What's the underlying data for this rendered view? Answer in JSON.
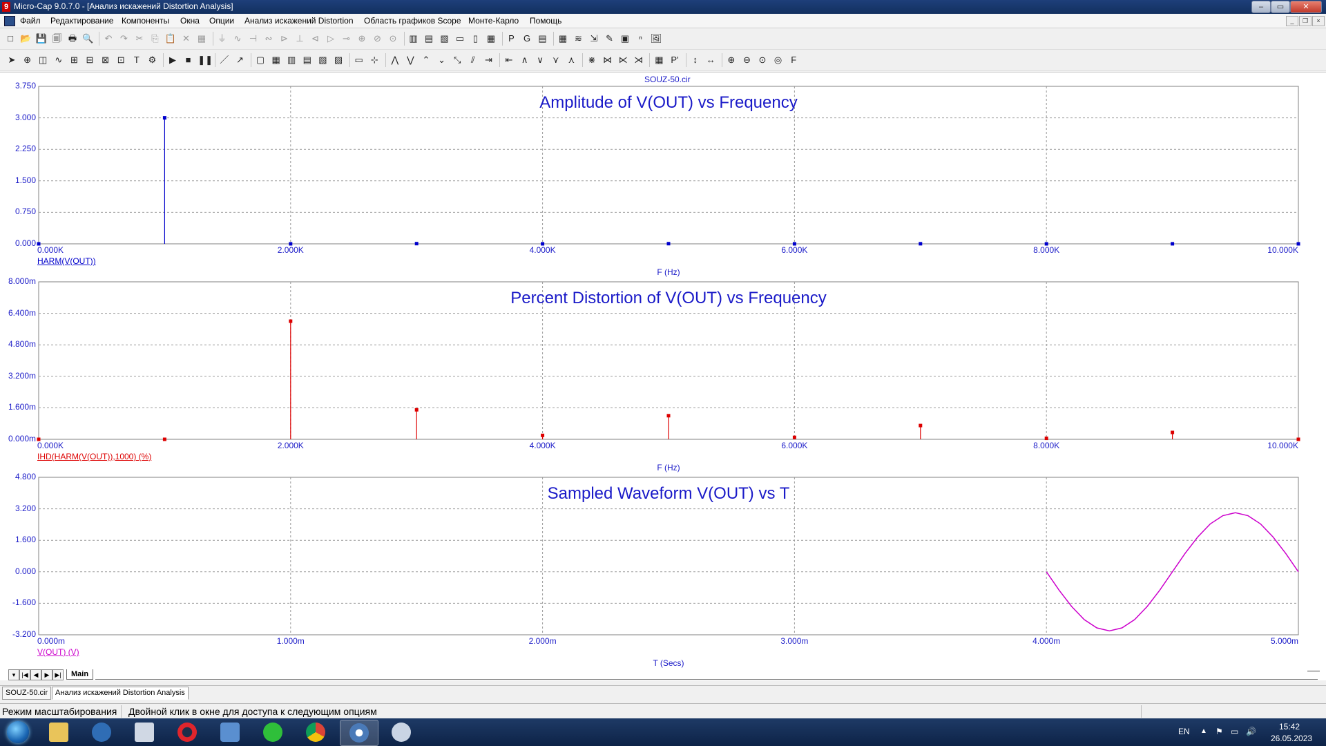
{
  "window": {
    "title": "Micro-Cap 9.0.7.0 - [Анализ искажений Distortion Analysis]",
    "app_icon": "9",
    "controls": [
      "–",
      "▭",
      "✕"
    ]
  },
  "menu": [
    "Файл",
    "Редактирование",
    "Компоненты",
    "Окна",
    "Опции",
    "Анализ искажений Distortion",
    "Область графиков Scope",
    "Монте-Карло",
    "Помощь"
  ],
  "toolbar1_icons": [
    "new-icon",
    "open-icon",
    "save-icon",
    "save-all-icon",
    "print-icon",
    "print-preview-icon",
    "undo-icon",
    "redo-icon",
    "cut-icon",
    "copy-icon",
    "paste-icon",
    "delete-icon",
    "select-all-icon",
    "ground-icon",
    "resistor-icon",
    "capacitor-icon",
    "inductor-icon",
    "diode-icon",
    "battery-icon",
    "transistor-icon",
    "opamp-icon",
    "switch-icon",
    "source-icon",
    "ammeter-icon",
    "voltmeter-icon",
    "tile-h-icon",
    "tile-v-icon",
    "cascade-icon",
    "window-icon",
    "window2-icon",
    "calculator-icon",
    "p-icon",
    "g-icon",
    "table-icon",
    "grid-icon",
    "wave-icon",
    "probe-icon",
    "pen-icon",
    "scope-icon",
    "xy-icon",
    "image-icon"
  ],
  "toolbar1_glyphs": [
    "□",
    "📂",
    "💾",
    "🗐",
    "🖶",
    "🔍",
    "↶",
    "↷",
    "✂",
    "⎘",
    "📋",
    "✕",
    "▦",
    "⏚",
    "∿",
    "⊣",
    "∾",
    "⊳",
    "⊥",
    "⊲",
    "▷",
    "⊸",
    "⊕",
    "⊘",
    "⊙",
    "▥",
    "▤",
    "▧",
    "▭",
    "▯",
    "▦",
    "P",
    "G",
    "▤",
    "▦",
    "≋",
    "⇲",
    "✎",
    "▣",
    "ⁿ",
    "🖼"
  ],
  "toolbar2_icons": [
    "pointer-icon",
    "zoom-select-icon",
    "graph-select-icon",
    "wave-tool-icon",
    "tag-icon",
    "tag2-icon",
    "tag3-icon",
    "tag4-icon",
    "text-icon",
    "properties-icon",
    "run-icon",
    "stop-icon",
    "pause-icon",
    "line-icon",
    "arrow-line-icon",
    "box-icon",
    "grid-toggle-icon",
    "grid1-icon",
    "grid2-icon",
    "grid3-icon",
    "grid4-icon",
    "scale-icon",
    "cursor-icon",
    "peak-icon",
    "valley-icon",
    "high-icon",
    "low-icon",
    "inflection-icon",
    "slope-icon",
    "go-right-icon",
    "go-left-icon",
    "wave1-icon",
    "wave2-icon",
    "wave3-icon",
    "wave4-icon",
    "tracking1-icon",
    "tracking2-icon",
    "tracking3-icon",
    "tracking4-icon",
    "data-points-icon",
    "token-icon",
    "scale-x-icon",
    "scale-y-icon",
    "zoom-in-icon",
    "zoom-out-icon",
    "zoom-fit-icon",
    "center-icon",
    "font-icon"
  ],
  "toolbar2_glyphs": [
    "➤",
    "⊕",
    "◫",
    "∿",
    "⊞",
    "⊟",
    "⊠",
    "⊡",
    "T",
    "⚙",
    "▶",
    "■",
    "❚❚",
    "／",
    "↗",
    "▢",
    "▦",
    "▥",
    "▤",
    "▧",
    "▨",
    "▭",
    "⊹",
    "⋀",
    "⋁",
    "⌃",
    "⌄",
    "⤡",
    "⫽",
    "⇥",
    "⇤",
    "∧",
    "∨",
    "⋎",
    "⋏",
    "⋇",
    "⋈",
    "⋉",
    "⋊",
    "▦",
    "P'",
    "↕",
    "↔",
    "⊕",
    "⊖",
    "⊙",
    "◎",
    "F"
  ],
  "sheet": {
    "file_label": "SOUZ-50.cir"
  },
  "plots": [
    {
      "title": "Amplitude of V(OUT) vs Frequency",
      "x_ticks": [
        "0.000K",
        "2.000K",
        "4.000K",
        "6.000K",
        "8.000K",
        "10.000K"
      ],
      "y_ticks": [
        "3.750",
        "3.000",
        "2.250",
        "1.500",
        "0.750",
        "0.000"
      ],
      "x_label": "F (Hz)",
      "expr": "HARM(V(OUT))",
      "color": "#0000cc"
    },
    {
      "title": "Percent Distortion of V(OUT) vs Frequency",
      "x_ticks": [
        "0.000K",
        "2.000K",
        "4.000K",
        "6.000K",
        "8.000K",
        "10.000K"
      ],
      "y_ticks": [
        "8.000m",
        "6.400m",
        "4.800m",
        "3.200m",
        "1.600m",
        "0.000m"
      ],
      "x_label": "F (Hz)",
      "expr": "IHD(HARM(V(OUT)),1000) (%)",
      "color": "#dd0000"
    },
    {
      "title": "Sampled Waveform  V(OUT) vs T",
      "x_ticks": [
        "0.000m",
        "1.000m",
        "2.000m",
        "3.000m",
        "4.000m",
        "5.000m"
      ],
      "y_ticks": [
        "4.800",
        "3.200",
        "1.600",
        "0.000",
        "-1.600",
        "-3.200"
      ],
      "x_label": "T (Secs)",
      "expr": "V(OUT) (V)",
      "color": "#cc00cc"
    }
  ],
  "chart_data": [
    {
      "type": "bar",
      "title": "Amplitude of V(OUT) vs Frequency",
      "xlabel": "F (Hz)",
      "ylabel": "",
      "x_unit": "kHz",
      "xlim": [
        0,
        10
      ],
      "ylim": [
        0,
        3.75
      ],
      "x": [
        0,
        1,
        2,
        3,
        4,
        5,
        6,
        7,
        8,
        9,
        10
      ],
      "values": [
        0.0,
        3.0,
        0.0,
        0.005,
        0.0,
        0.004,
        0.0,
        0.002,
        0.0,
        0.001,
        0.0
      ],
      "series": [
        {
          "name": "HARM(V(OUT))",
          "color": "#0000cc"
        }
      ],
      "grid": true
    },
    {
      "type": "bar",
      "title": "Percent Distortion of V(OUT) vs Frequency",
      "xlabel": "F (Hz)",
      "ylabel": "",
      "x_unit": "kHz",
      "y_unit": "m",
      "xlim": [
        0,
        10
      ],
      "ylim": [
        0,
        8.0
      ],
      "x": [
        0,
        1,
        2,
        3,
        4,
        5,
        6,
        7,
        8,
        9,
        10
      ],
      "values": [
        0.0,
        0.0,
        6.0,
        1.5,
        0.2,
        1.2,
        0.1,
        0.7,
        0.05,
        0.35,
        0.0
      ],
      "series": [
        {
          "name": "IHD(HARM(V(OUT)),1000) (%)",
          "color": "#dd0000"
        }
      ],
      "grid": true
    },
    {
      "type": "line",
      "title": "Sampled Waveform  V(OUT) vs T",
      "xlabel": "T (Secs)",
      "ylabel": "",
      "x_unit": "ms",
      "xlim": [
        0,
        5
      ],
      "ylim": [
        -3.2,
        4.8
      ],
      "x": [
        4.0,
        4.05,
        4.1,
        4.15,
        4.2,
        4.25,
        4.3,
        4.35,
        4.4,
        4.45,
        4.5,
        4.55,
        4.6,
        4.65,
        4.7,
        4.75,
        4.8,
        4.85,
        4.9,
        4.95,
        5.0
      ],
      "values": [
        0.0,
        -0.93,
        -1.76,
        -2.43,
        -2.85,
        -3.0,
        -2.85,
        -2.43,
        -1.76,
        -0.93,
        0.0,
        0.93,
        1.76,
        2.43,
        2.85,
        3.0,
        2.85,
        2.43,
        1.76,
        0.93,
        0.0
      ],
      "series": [
        {
          "name": "V(OUT) (V)",
          "color": "#cc00cc"
        }
      ],
      "grid": true
    }
  ],
  "sheet_tabs": {
    "nav": [
      "▾",
      "|◀",
      "◀",
      "▶",
      "▶|"
    ],
    "active": "Main"
  },
  "doc_tabs": [
    "SOUZ-50.cir",
    "Анализ искажений Distortion Analysis"
  ],
  "status": {
    "mode": "Режим масштабирования",
    "hint": "Двойной клик в окне для доступа к следующим опциям"
  },
  "taskbar": {
    "apps": [
      "start-icon",
      "explorer-icon",
      "kde-icon",
      "calculator-icon",
      "opera-icon",
      "mail-icon",
      "game-icon",
      "chrome-icon",
      "microcap-icon",
      "paint-icon"
    ],
    "lang": "EN",
    "time": "15:42",
    "date": "26.05.2023",
    "tray_glyphs": [
      "▲",
      "⚑",
      "▭",
      "🔊"
    ]
  }
}
